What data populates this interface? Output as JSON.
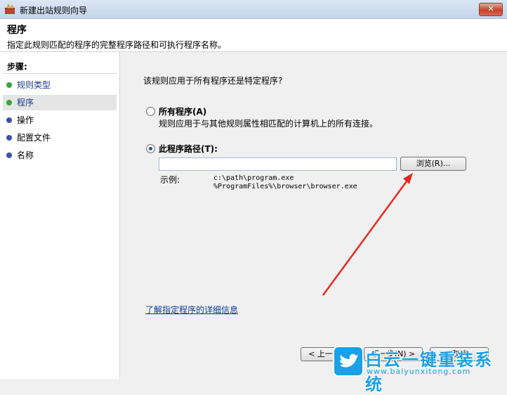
{
  "window": {
    "title": "新建出站规则向导",
    "close_label": "✕"
  },
  "header": {
    "title": "程序",
    "description": "指定此规则匹配的程序的完整程序路径和可执行程序名称。"
  },
  "sidebar": {
    "steps_label": "步骤:",
    "items": [
      {
        "label": "规则类型",
        "state": "done"
      },
      {
        "label": "程序",
        "state": "current"
      },
      {
        "label": "操作",
        "state": "pending"
      },
      {
        "label": "配置文件",
        "state": "pending"
      },
      {
        "label": "名称",
        "state": "pending"
      }
    ]
  },
  "main": {
    "question": "该规则应用于所有程序还是特定程序?",
    "option_all": {
      "label": "所有程序(A)",
      "description": "规则应用于与其他规则属性相匹配的计算机上的所有连接。",
      "selected": false
    },
    "option_path": {
      "label": "此程序路径(T):",
      "selected": true,
      "input_value": "",
      "browse_label": "浏览(R)..."
    },
    "example_label": "示例:",
    "example_lines": [
      "c:\\path\\program.exe",
      "%ProgramFiles%\\browser\\browser.exe"
    ],
    "learn_more_link": "了解指定程序的详细信息"
  },
  "footer": {
    "back_label": "< 上一步(B)",
    "next_label": "下一步(N) >",
    "cancel_label": "取消"
  },
  "watermark": {
    "text": "白云一键重装系统",
    "url": "www.baiyunxitong.com"
  },
  "colors": {
    "done_dot": "#3aa63a",
    "pending_dot": "#3d4fa8",
    "link": "#0b3c9a",
    "arrow": "#e8281e"
  }
}
